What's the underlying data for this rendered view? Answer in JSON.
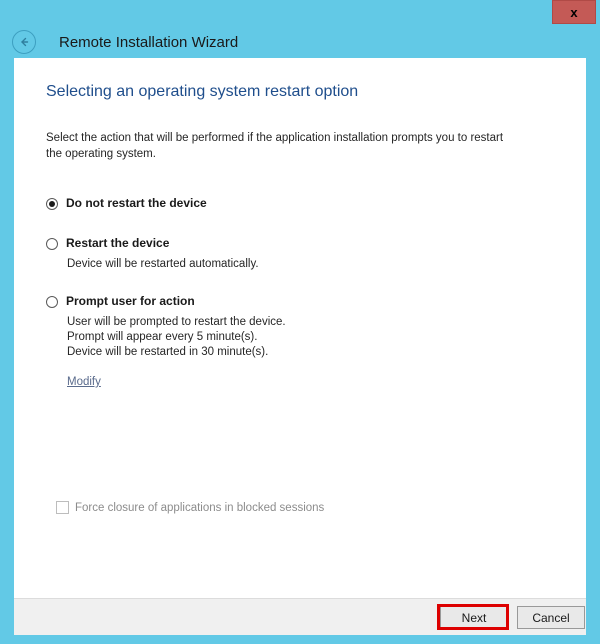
{
  "window": {
    "title": "Remote Installation Wizard",
    "close_label": "x",
    "back_icon": "back-arrow-icon",
    "chrome_color": "#62c9e6",
    "close_button_color": "#c45a56"
  },
  "page": {
    "heading": "Selecting an operating system restart option",
    "heading_color": "#1f4e8c",
    "instruction": "Select the action that will be performed if the application installation prompts you to restart the operating system."
  },
  "restart_options": [
    {
      "label": "Do not restart the device",
      "selected": true,
      "description_lines": []
    },
    {
      "label": "Restart the device",
      "selected": false,
      "description_lines": [
        "Device will be restarted automatically."
      ]
    },
    {
      "label": "Prompt user for action",
      "selected": false,
      "description_lines": [
        "User will be prompted to restart the device.",
        "Prompt will appear every 5 minute(s).",
        "Device will be restarted in 30 minute(s)."
      ]
    }
  ],
  "modify_link": {
    "label": "Modify",
    "color": "#5a6b8c"
  },
  "force_closure": {
    "label": "Force closure of applications in blocked sessions",
    "checked": false,
    "enabled": false
  },
  "footer": {
    "next_label": "Next",
    "cancel_label": "Cancel"
  },
  "annotation": {
    "target": "Next",
    "color": "#dd0000"
  }
}
